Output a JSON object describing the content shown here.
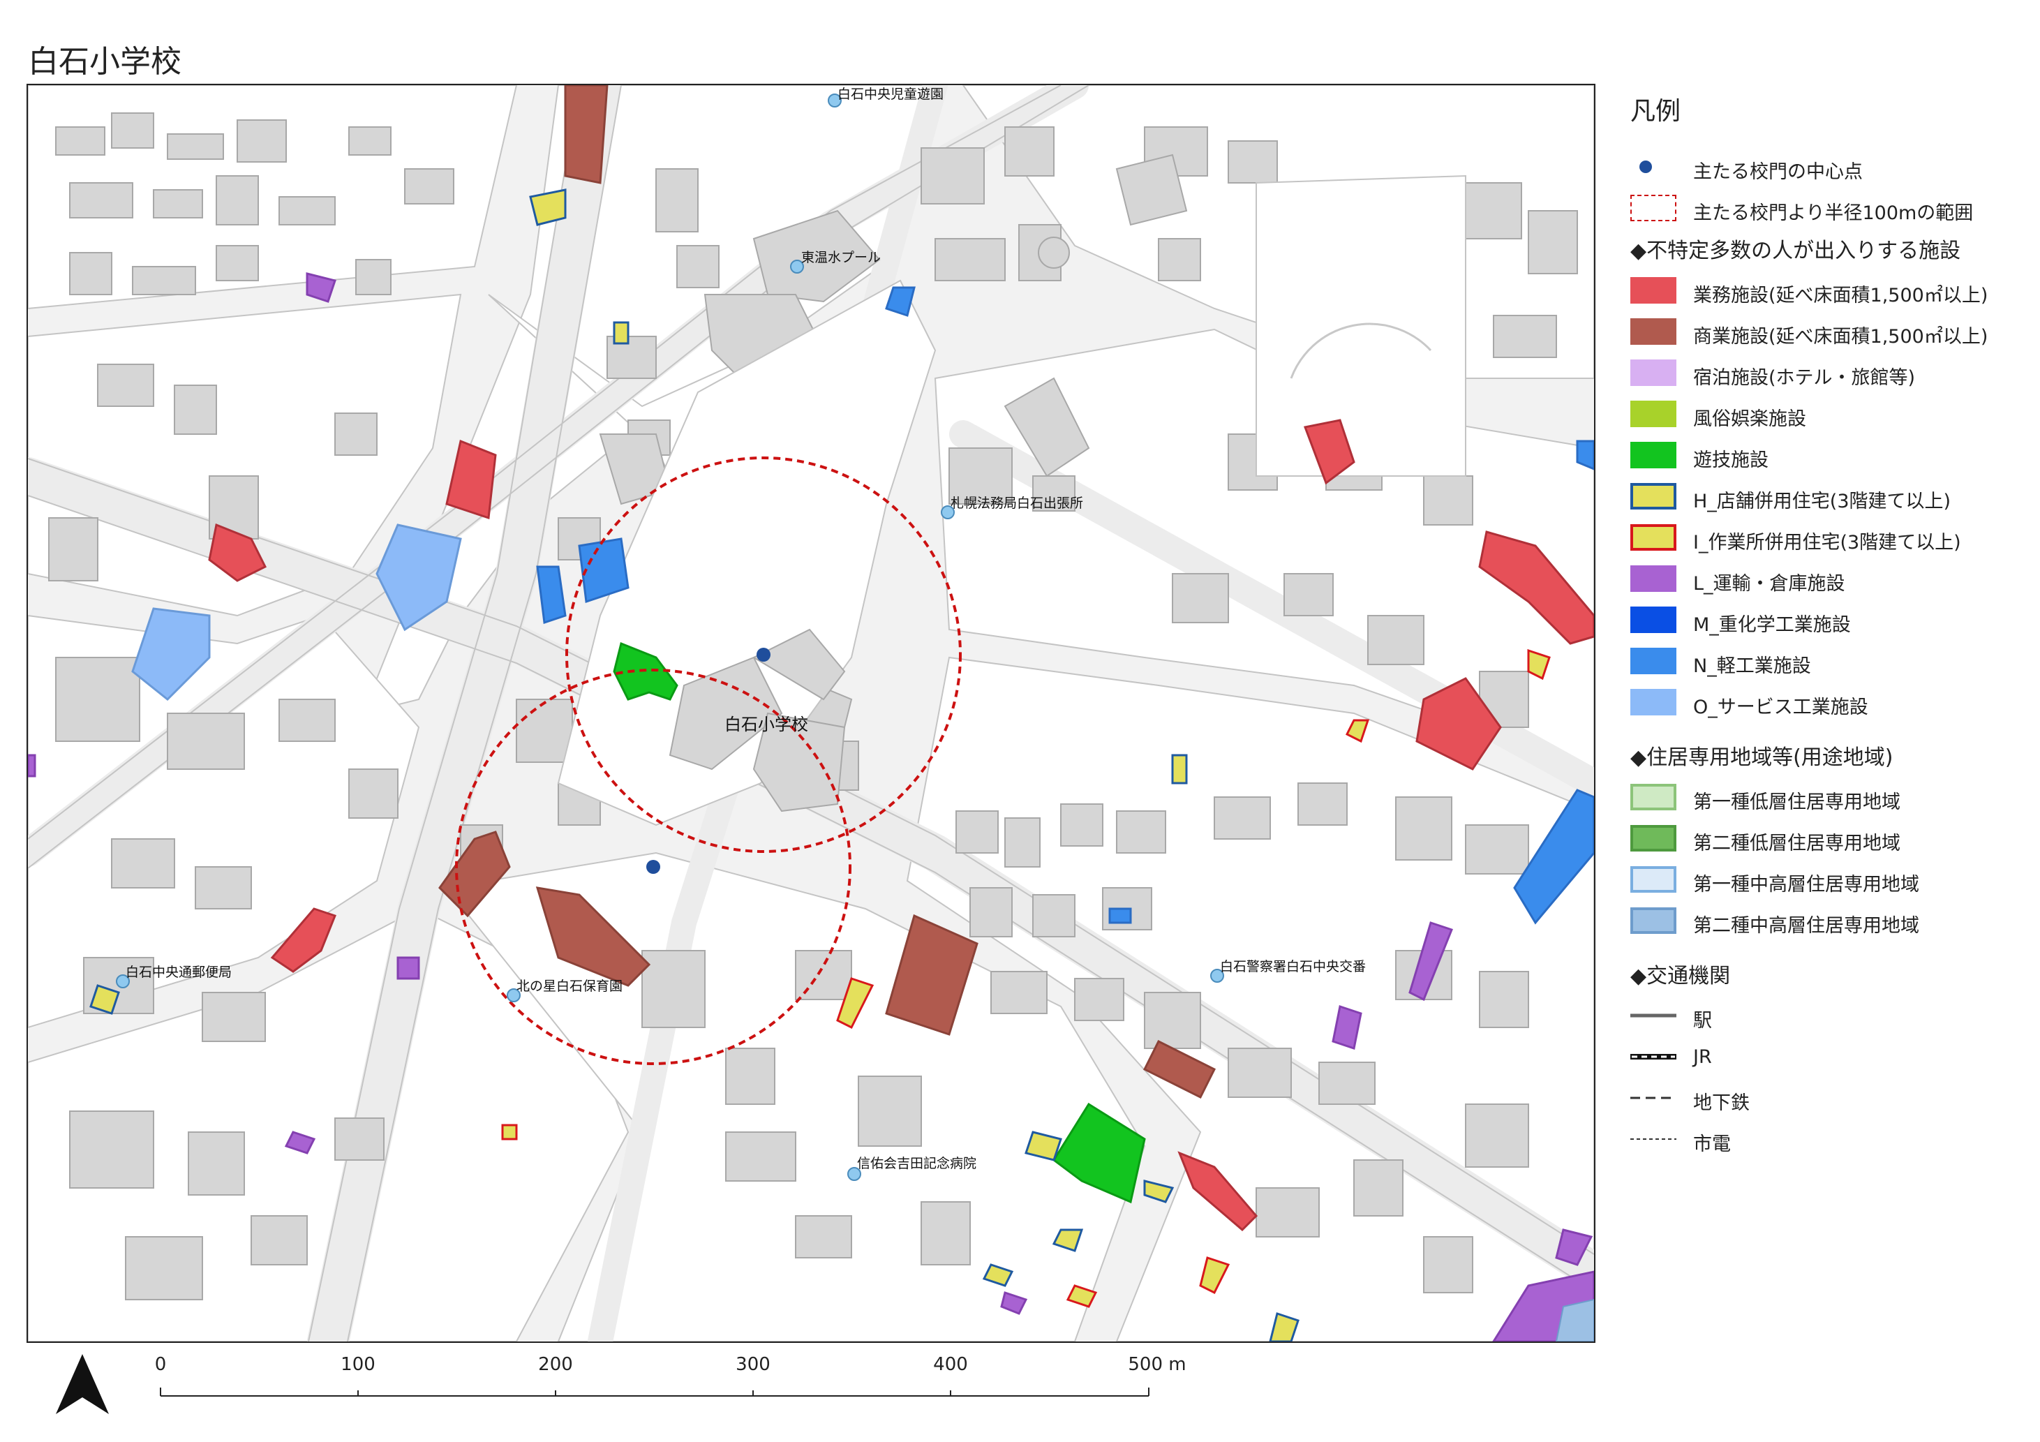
{
  "title": "白石小学校",
  "map": {
    "place_labels": [
      {
        "text": "白石中央児童遊園"
      },
      {
        "text": "東温水プール"
      },
      {
        "text": "札幌法務局白石出張所"
      },
      {
        "text": "白石小学校"
      },
      {
        "text": "白石中央通郵便局"
      },
      {
        "text": "北の星白石保育園"
      },
      {
        "text": "白石警察署白石中央交番"
      },
      {
        "text": "信佑会吉田記念病院"
      }
    ],
    "colors": {
      "background": "#f2f2f2",
      "block": "#ffffff",
      "building": "#d6d6d6",
      "building_stroke": "#a8a8a8",
      "road_stroke": "#c4c4c4",
      "buffer_circle": "#cc1111",
      "gate_point": "#1f4e9c",
      "poi_point": "#8fc9ef"
    }
  },
  "legend": {
    "title": "凡例",
    "items": [
      {
        "label": "主たる校門の中心点",
        "symbol": "point",
        "fill": "#1f4e9c"
      },
      {
        "label": "主たる校門より半径100mの範囲",
        "symbol": "dashed-box",
        "stroke": "#cc1111"
      },
      {
        "label": "◆不特定多数の人が出入りする施設",
        "symbol": "heading"
      },
      {
        "label": "業務施設(延べ床面積1,500㎡以上)",
        "symbol": "box",
        "fill": "#e65058"
      },
      {
        "label": "商業施設(延べ床面積1,500㎡以上)",
        "symbol": "box",
        "fill": "#b05a4e"
      },
      {
        "label": "宿泊施設(ホテル・旅館等)",
        "symbol": "box",
        "fill": "#d8b0f2"
      },
      {
        "label": "風俗娯楽施設",
        "symbol": "box",
        "fill": "#a8d22a"
      },
      {
        "label": "遊技施設",
        "symbol": "box",
        "fill": "#12c41f"
      },
      {
        "label": "H_店舗併用住宅(3階建て以上)",
        "symbol": "box",
        "fill": "#e4e05c",
        "stroke": "#1f5aa0"
      },
      {
        "label": "I_作業所併用住宅(3階建て以上)",
        "symbol": "box",
        "fill": "#e4e05c",
        "stroke": "#d8181c"
      },
      {
        "label": "L_運輸・倉庫施設",
        "symbol": "box",
        "fill": "#a862d2"
      },
      {
        "label": "M_重化学工業施設",
        "symbol": "box",
        "fill": "#0a4fe4"
      },
      {
        "label": "N_軽工業施設",
        "symbol": "box",
        "fill": "#3a8cec"
      },
      {
        "label": "O_サービス工業施設",
        "symbol": "box",
        "fill": "#8cbaf8"
      },
      {
        "label": "◆住居専用地域等(用途地域)",
        "symbol": "heading"
      },
      {
        "label": "第一種低層住居専用地域",
        "symbol": "box",
        "fill": "#cfeac4",
        "stroke": "#8cc47a"
      },
      {
        "label": "第二種低層住居専用地域",
        "symbol": "box",
        "fill": "#6fba5a",
        "stroke": "#4e9a3e"
      },
      {
        "label": "第一種中高層住居専用地域",
        "symbol": "box",
        "fill": "#dceaf8",
        "stroke": "#7aaee0"
      },
      {
        "label": "第二種中高層住居専用地域",
        "symbol": "box",
        "fill": "#9cc0e4",
        "stroke": "#6e9ccc"
      },
      {
        "label": "◆交通機関",
        "symbol": "heading"
      },
      {
        "label": "駅",
        "symbol": "line-solid"
      },
      {
        "label": "JR",
        "symbol": "line-jr"
      },
      {
        "label": "地下鉄",
        "symbol": "line-dash"
      },
      {
        "label": "市電",
        "symbol": "line-dot"
      }
    ]
  },
  "scale_bar": {
    "ticks": [
      "0",
      "100",
      "200",
      "300",
      "400",
      "500 m"
    ]
  },
  "north_arrow": {
    "icon": "north-arrow-icon"
  }
}
